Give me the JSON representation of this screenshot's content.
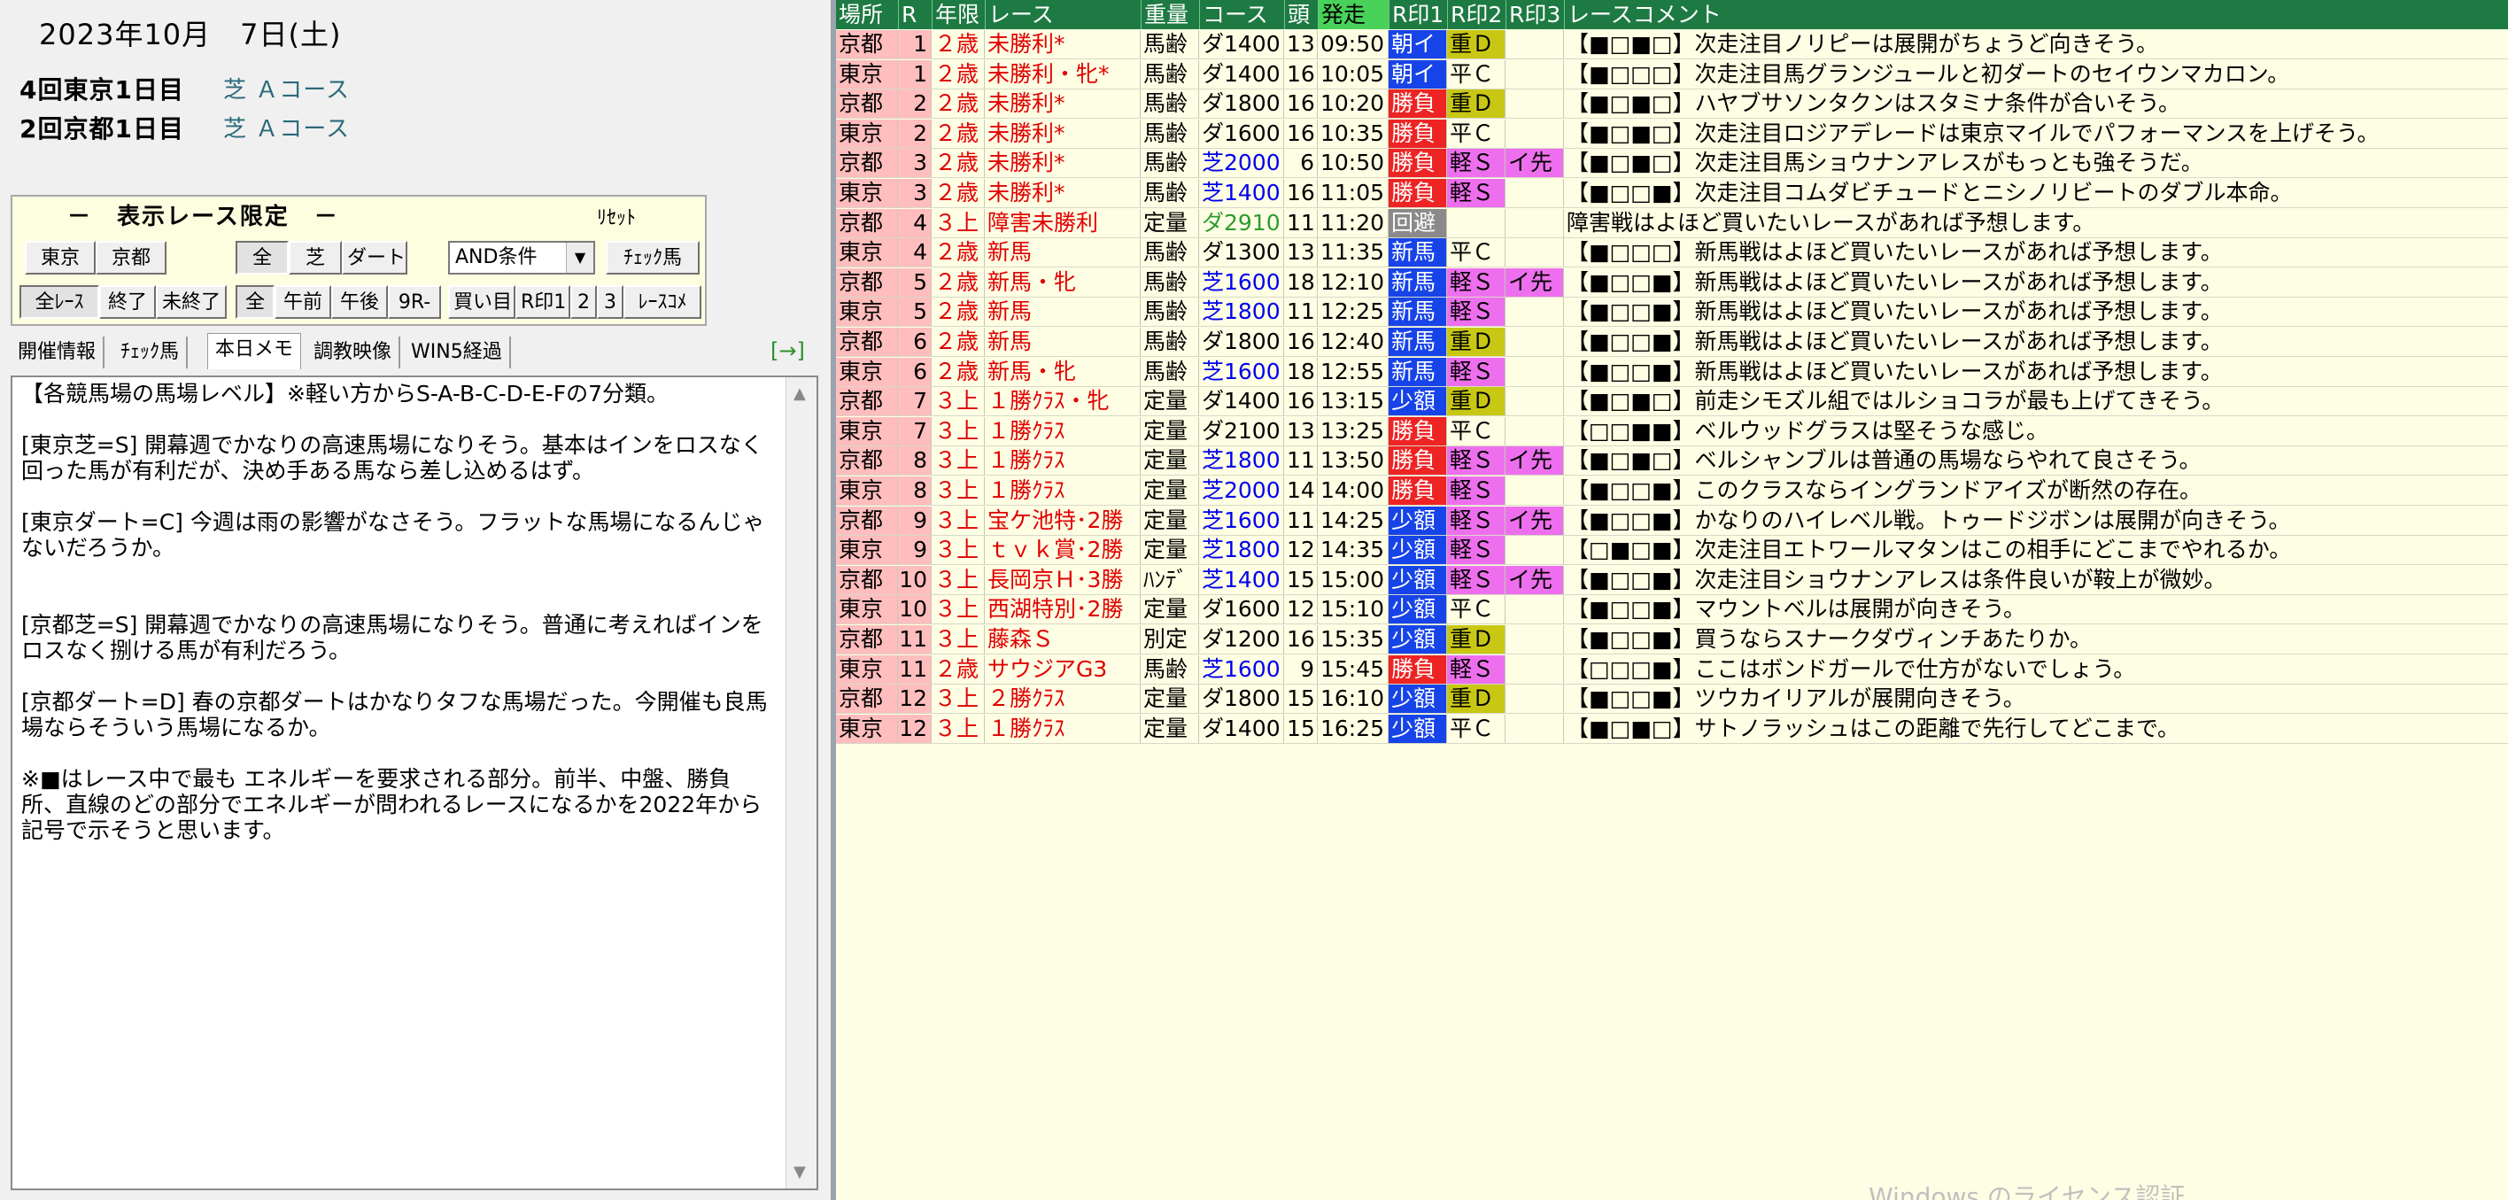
{
  "date": "2023年10月　7日(土)",
  "meetings": [
    {
      "name": "4回東京1日目",
      "course": "芝 Ａコース"
    },
    {
      "name": "2回京都1日目",
      "course": "芝 Ａコース"
    }
  ],
  "filter": {
    "title": "－　表示レース限定　－",
    "reset": "ﾘｾｯﾄ",
    "buttons": {
      "tokyo": "東京",
      "kyoto": "京都",
      "all": "全",
      "turf": "芝",
      "dirt": "ダート",
      "check_horse": "ﾁｪｯｸ馬",
      "all_races": "全ﾚｰｽ",
      "finished": "終了",
      "unfinished": "未終了",
      "all2": "全",
      "am": "午前",
      "pm": "午後",
      "r9": "9R-",
      "buy": "買い目",
      "mark1": "R印1",
      "mark2": "2",
      "mark3": "3",
      "race_comment": "ﾚｰｽｺﾒ"
    },
    "condition": "AND条件"
  },
  "tabs": [
    "開催情報",
    "ﾁｪｯｸ馬",
    "本日メモ",
    "調教映像",
    "WIN5経過"
  ],
  "arrow": "[→]",
  "memo": "【各競馬場の馬場レベル】※軽い方からS-A-B-C-D-E-Fの7分類。\n\n[東京芝=S] 開幕週でかなりの高速馬場になりそう。基本はインをロスなく回った馬が有利だが、決め手ある馬なら差し込めるはず。\n\n[東京ダート=C] 今週は雨の影響がなさそう。フラットな馬場になるんじゃないだろうか。\n\n\n[京都芝=S] 開幕週でかなりの高速馬場になりそう。普通に考えればインをロスなく捌ける馬が有利だろう。\n\n[京都ダート=D] 春の京都ダートはかなりタフな馬場だった。今開催も良馬場ならそういう馬場になるか。\n\n※■はレース中で最も エネルギーを要求される部分。前半、中盤、勝負所、直線のどの部分でエネルギーが問われるレースになるかを2022年から記号で示そうと思います。",
  "table": {
    "headers": [
      "場所",
      "R",
      "年限",
      "レース",
      "重量",
      "コース",
      "頭",
      "発走",
      "R印1",
      "R印2",
      "R印3",
      "レースコメント"
    ],
    "rows": [
      {
        "place": "京都",
        "r": "1",
        "age": "２歳",
        "race": "未勝利*",
        "wt": "馬齢",
        "course": "ダ1400",
        "ctype": "dirt",
        "heads": "13",
        "start": "09:50",
        "m1": "朝イ",
        "m1c": "asa",
        "m2": "重Ｄ",
        "m2c": "heavy",
        "m3": "",
        "comment": "【■□■□】次走注目ノリピーは展開がちょうど向きそう。"
      },
      {
        "place": "東京",
        "r": "1",
        "age": "２歳",
        "race": "未勝利・牝*",
        "wt": "馬齢",
        "course": "ダ1400",
        "ctype": "dirt",
        "heads": "16",
        "start": "10:05",
        "m1": "朝イ",
        "m1c": "asa",
        "m2": "平Ｃ",
        "m2c": "flat",
        "m3": "",
        "comment": "【■□□□】次走注目馬グランジュールと初ダートのセイウンマカロン。"
      },
      {
        "place": "京都",
        "r": "2",
        "age": "２歳",
        "race": "未勝利*",
        "wt": "馬齢",
        "course": "ダ1800",
        "ctype": "dirt",
        "heads": "16",
        "start": "10:20",
        "m1": "勝負",
        "m1c": "shobu",
        "m2": "重Ｄ",
        "m2c": "heavy",
        "m3": "",
        "comment": "【■□■□】ハヤブサソンタクンはスタミナ条件が合いそう。"
      },
      {
        "place": "東京",
        "r": "2",
        "age": "２歳",
        "race": "未勝利*",
        "wt": "馬齢",
        "course": "ダ1600",
        "ctype": "dirt",
        "heads": "16",
        "start": "10:35",
        "m1": "勝負",
        "m1c": "shobu",
        "m2": "平Ｃ",
        "m2c": "flat",
        "m3": "",
        "comment": "【■□■□】次走注目ロジアデレードは東京マイルでパフォーマンスを上げそう。"
      },
      {
        "place": "京都",
        "r": "3",
        "age": "２歳",
        "race": "未勝利*",
        "wt": "馬齢",
        "course": "芝2000",
        "ctype": "turf",
        "heads": "6",
        "start": "10:50",
        "m1": "勝負",
        "m1c": "shobu",
        "m2": "軽Ｓ",
        "m2c": "light",
        "m3": "イ先",
        "comment": "【■□■□】次走注目馬ショウナンアレスがもっとも強そうだ。"
      },
      {
        "place": "東京",
        "r": "3",
        "age": "２歳",
        "race": "未勝利*",
        "wt": "馬齢",
        "course": "芝1400",
        "ctype": "turf",
        "heads": "16",
        "start": "11:05",
        "m1": "勝負",
        "m1c": "shobu",
        "m2": "軽Ｓ",
        "m2c": "light",
        "m3": "",
        "comment": "【■□□■】次走注目コムダビチュードとニシノリビートのダブル本命。"
      },
      {
        "place": "京都",
        "r": "4",
        "age": "３上",
        "race": "障害未勝利",
        "wt": "定量",
        "course": "ダ2910",
        "ctype": "jump",
        "heads": "11",
        "start": "11:20",
        "m1": "回避",
        "m1c": "kaihi",
        "m2": "",
        "m2c": "flat",
        "m3": "",
        "comment": "障害戦はよほど買いたいレースがあれば予想します。"
      },
      {
        "place": "東京",
        "r": "4",
        "age": "２歳",
        "race": "新馬",
        "wt": "馬齢",
        "course": "ダ1300",
        "ctype": "dirt",
        "heads": "13",
        "start": "11:35",
        "m1": "新馬",
        "m1c": "shinba",
        "m2": "平Ｃ",
        "m2c": "flat",
        "m3": "",
        "comment": "【■□□□】新馬戦はよほど買いたいレースがあれば予想します。"
      },
      {
        "place": "京都",
        "r": "5",
        "age": "２歳",
        "race": "新馬・牝",
        "wt": "馬齢",
        "course": "芝1600",
        "ctype": "turf",
        "heads": "18",
        "start": "12:10",
        "m1": "新馬",
        "m1c": "shinba",
        "m2": "軽Ｓ",
        "m2c": "light",
        "m3": "イ先",
        "comment": "【■□□■】新馬戦はよほど買いたいレースがあれば予想します。"
      },
      {
        "place": "東京",
        "r": "5",
        "age": "２歳",
        "race": "新馬",
        "wt": "馬齢",
        "course": "芝1800",
        "ctype": "turf",
        "heads": "11",
        "start": "12:25",
        "m1": "新馬",
        "m1c": "shinba",
        "m2": "軽Ｓ",
        "m2c": "light",
        "m3": "",
        "comment": "【■□□■】新馬戦はよほど買いたいレースがあれば予想します。"
      },
      {
        "place": "京都",
        "r": "6",
        "age": "２歳",
        "race": "新馬",
        "wt": "馬齢",
        "course": "ダ1800",
        "ctype": "dirt",
        "heads": "16",
        "start": "12:40",
        "m1": "新馬",
        "m1c": "shinba",
        "m2": "重Ｄ",
        "m2c": "heavy",
        "m3": "",
        "comment": "【■□□■】新馬戦はよほど買いたいレースがあれば予想します。"
      },
      {
        "place": "東京",
        "r": "6",
        "age": "２歳",
        "race": "新馬・牝",
        "wt": "馬齢",
        "course": "芝1600",
        "ctype": "turf",
        "heads": "18",
        "start": "12:55",
        "m1": "新馬",
        "m1c": "shinba",
        "m2": "軽Ｓ",
        "m2c": "light",
        "m3": "",
        "comment": "【■□□■】新馬戦はよほど買いたいレースがあれば予想します。"
      },
      {
        "place": "京都",
        "r": "7",
        "age": "３上",
        "race": "１勝ｸﾗｽ・牝",
        "wt": "定量",
        "course": "ダ1400",
        "ctype": "dirt",
        "heads": "16",
        "start": "13:15",
        "m1": "少額",
        "m1c": "shogaku",
        "m2": "重Ｄ",
        "m2c": "heavy",
        "m3": "",
        "comment": "【■□■□】前走シモズル組ではルショコラが最も上げてきそう。"
      },
      {
        "place": "東京",
        "r": "7",
        "age": "３上",
        "race": "１勝ｸﾗｽ",
        "wt": "定量",
        "course": "ダ2100",
        "ctype": "dirt",
        "heads": "13",
        "start": "13:25",
        "m1": "勝負",
        "m1c": "shobu",
        "m2": "平Ｃ",
        "m2c": "flat",
        "m3": "",
        "comment": "【□□■■】ベルウッドグラスは堅そうな感じ。"
      },
      {
        "place": "京都",
        "r": "8",
        "age": "３上",
        "race": "１勝ｸﾗｽ",
        "wt": "定量",
        "course": "芝1800",
        "ctype": "turf",
        "heads": "11",
        "start": "13:50",
        "m1": "勝負",
        "m1c": "shobu",
        "m2": "軽Ｓ",
        "m2c": "light",
        "m3": "イ先",
        "comment": "【■□■□】ベルシャンブルは普通の馬場ならやれて良さそう。"
      },
      {
        "place": "東京",
        "r": "8",
        "age": "３上",
        "race": "１勝ｸﾗｽ",
        "wt": "定量",
        "course": "芝2000",
        "ctype": "turf",
        "heads": "14",
        "start": "14:00",
        "m1": "勝負",
        "m1c": "shobu",
        "m2": "軽Ｓ",
        "m2c": "light",
        "m3": "",
        "comment": "【■□□■】このクラスならイングランドアイズが断然の存在。"
      },
      {
        "place": "京都",
        "r": "9",
        "age": "３上",
        "race": "宝ケ池特･2勝",
        "wt": "定量",
        "course": "芝1600",
        "ctype": "turf",
        "heads": "11",
        "start": "14:25",
        "m1": "少額",
        "m1c": "shogaku",
        "m2": "軽Ｓ",
        "m2c": "light",
        "m3": "イ先",
        "comment": "【■□□■】かなりのハイレベル戦。トゥードジボンは展開が向きそう。"
      },
      {
        "place": "東京",
        "r": "9",
        "age": "３上",
        "race": "ｔｖｋ賞･2勝",
        "wt": "定量",
        "course": "芝1800",
        "ctype": "turf",
        "heads": "12",
        "start": "14:35",
        "m1": "少額",
        "m1c": "shogaku",
        "m2": "軽Ｓ",
        "m2c": "light",
        "m3": "",
        "comment": "【□■□■】次走注目エトワールマタンはこの相手にどこまでやれるか。"
      },
      {
        "place": "京都",
        "r": "10",
        "age": "３上",
        "race": "長岡京Ｈ･3勝",
        "wt": "ﾊﾝﾃﾞ",
        "course": "芝1400",
        "ctype": "turf",
        "heads": "15",
        "start": "15:00",
        "m1": "少額",
        "m1c": "shogaku",
        "m2": "軽Ｓ",
        "m2c": "light",
        "m3": "イ先",
        "comment": "【■□□■】次走注目ショウナンアレスは条件良いが鞍上が微妙。"
      },
      {
        "place": "東京",
        "r": "10",
        "age": "３上",
        "race": "西湖特別･2勝",
        "wt": "定量",
        "course": "ダ1600",
        "ctype": "dirt",
        "heads": "12",
        "start": "15:10",
        "m1": "少額",
        "m1c": "shogaku",
        "m2": "平Ｃ",
        "m2c": "flat",
        "m3": "",
        "comment": "【■□□■】マウントベルは展開が向きそう。"
      },
      {
        "place": "京都",
        "r": "11",
        "age": "３上",
        "race": "藤森Ｓ",
        "wt": "別定",
        "course": "ダ1200",
        "ctype": "dirt",
        "heads": "16",
        "start": "15:35",
        "m1": "少額",
        "m1c": "shogaku",
        "m2": "重Ｄ",
        "m2c": "heavy",
        "m3": "",
        "comment": "【■□□■】買うならスナークダヴィンチあたりか。"
      },
      {
        "place": "東京",
        "r": "11",
        "age": "２歳",
        "race": "サウジアG3",
        "wt": "馬齢",
        "course": "芝1600",
        "ctype": "turf",
        "heads": "9",
        "start": "15:45",
        "m1": "勝負",
        "m1c": "shobu",
        "m2": "軽Ｓ",
        "m2c": "light",
        "m3": "",
        "comment": "【□□□■】ここはボンドガールで仕方がないでしょう。"
      },
      {
        "place": "京都",
        "r": "12",
        "age": "３上",
        "race": "２勝ｸﾗｽ",
        "wt": "定量",
        "course": "ダ1800",
        "ctype": "dirt",
        "heads": "15",
        "start": "16:10",
        "m1": "少額",
        "m1c": "shogaku",
        "m2": "重Ｄ",
        "m2c": "heavy",
        "m3": "",
        "comment": "【■□□■】ツウカイリアルが展開向きそう。"
      },
      {
        "place": "東京",
        "r": "12",
        "age": "３上",
        "race": "１勝ｸﾗｽ",
        "wt": "定量",
        "course": "ダ1400",
        "ctype": "dirt",
        "heads": "15",
        "start": "16:25",
        "m1": "少額",
        "m1c": "shogaku",
        "m2": "平Ｃ",
        "m2c": "flat",
        "m3": "",
        "comment": "【■□■□】サトノラッシュはこの距離で先行してどこまで。"
      }
    ]
  },
  "watermark": "Windows のライセンス認証",
  "colors": {
    "header_bg": "#1e7a43",
    "start_header_bg": "#49d259",
    "place_bg": "#ffbdbd",
    "table_bg": "#fefee4",
    "red_text": "#e00000",
    "turf_text": "#0000ee",
    "blue_mark": "#1744e8",
    "red_mark": "#ee2424",
    "grey_mark": "#8a8a8a",
    "heavy_bg": "#c8c814",
    "light_bg": "#ee6fee"
  }
}
